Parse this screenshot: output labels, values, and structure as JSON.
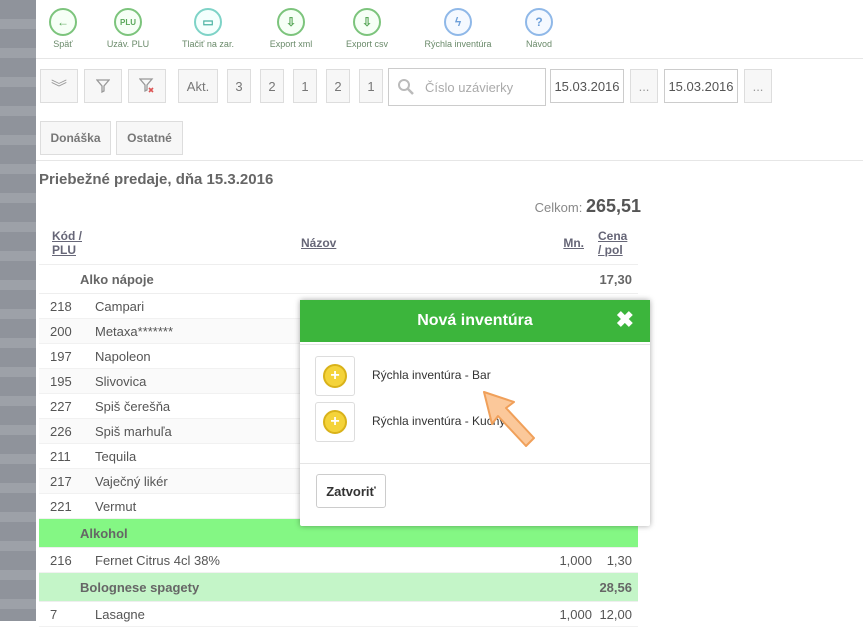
{
  "toolbar": {
    "items": [
      {
        "label": "Späť",
        "icon": "back-arrow-icon",
        "glyph": "←"
      },
      {
        "label": "Uzáv. PLU",
        "icon": "plu-icon",
        "glyph": "PLU"
      },
      {
        "label": "Tlačiť na zar.",
        "icon": "printer-icon",
        "glyph": "▭"
      },
      {
        "label": "Export xml",
        "icon": "export-xml-icon",
        "glyph": "⇩"
      },
      {
        "label": "Export csv",
        "icon": "export-csv-icon",
        "glyph": "⇩"
      },
      {
        "label": "Rýchla inventúra",
        "icon": "lightning-icon",
        "glyph": "ϟ"
      },
      {
        "label": "Návod",
        "icon": "help-icon",
        "glyph": "?"
      }
    ]
  },
  "filters": {
    "akt_label": "Akt.",
    "counters": [
      "3",
      "2",
      "1",
      "2",
      "1"
    ],
    "search_placeholder": "Číslo uzávierky",
    "date_from": "15.03.2016",
    "date_to": "15.03.2016",
    "ellipsis": "..."
  },
  "tabs": [
    "Donáška",
    "Ostatné"
  ],
  "report": {
    "title": "Priebežné predaje, dňa 15.3.2016",
    "total_label": "Celkom:",
    "total_value": "265,51"
  },
  "table": {
    "headers": {
      "kod": "Kód / PLU",
      "nazov": "Názov",
      "mn": "Mn.",
      "cena": "Cena / pol"
    },
    "group1": {
      "name": "Alko nápoje",
      "value": "17,30"
    },
    "rows1": [
      {
        "kod": "218",
        "nazov": "Campari",
        "mn": "",
        "cena": ""
      },
      {
        "kod": "200",
        "nazov": "Metaxa*******",
        "mn": "",
        "cena": ""
      },
      {
        "kod": "197",
        "nazov": "Napoleon",
        "mn": "",
        "cena": ""
      },
      {
        "kod": "195",
        "nazov": "Slivovica",
        "mn": "",
        "cena": ""
      },
      {
        "kod": "227",
        "nazov": "Spiš čerešňa",
        "mn": "",
        "cena": ""
      },
      {
        "kod": "226",
        "nazov": "Spiš marhuľa",
        "mn": "",
        "cena": ""
      },
      {
        "kod": "211",
        "nazov": "Tequila",
        "mn": "",
        "cena": ""
      },
      {
        "kod": "217",
        "nazov": "Vaječný likér",
        "mn": "",
        "cena": ""
      },
      {
        "kod": "221",
        "nazov": "Vermut",
        "mn": "",
        "cena": ""
      }
    ],
    "group2": {
      "name": "Alkohol",
      "value": ""
    },
    "rows2": [
      {
        "kod": "216",
        "nazov": "Fernet Citrus 4cl 38%",
        "mn": "1,000",
        "cena": "1,30"
      }
    ],
    "group3": {
      "name": "Bolognese spagety",
      "value": "28,56"
    },
    "rows3": [
      {
        "kod": "7",
        "nazov": "Lasagne",
        "mn": "1,000",
        "cena": "12,00"
      }
    ]
  },
  "modal": {
    "title": "Nová inventúra",
    "options": [
      "Rýchla inventúra - Bar",
      "Rýchla inventúra - Kuchyňa"
    ],
    "close_label": "Zatvoriť"
  }
}
